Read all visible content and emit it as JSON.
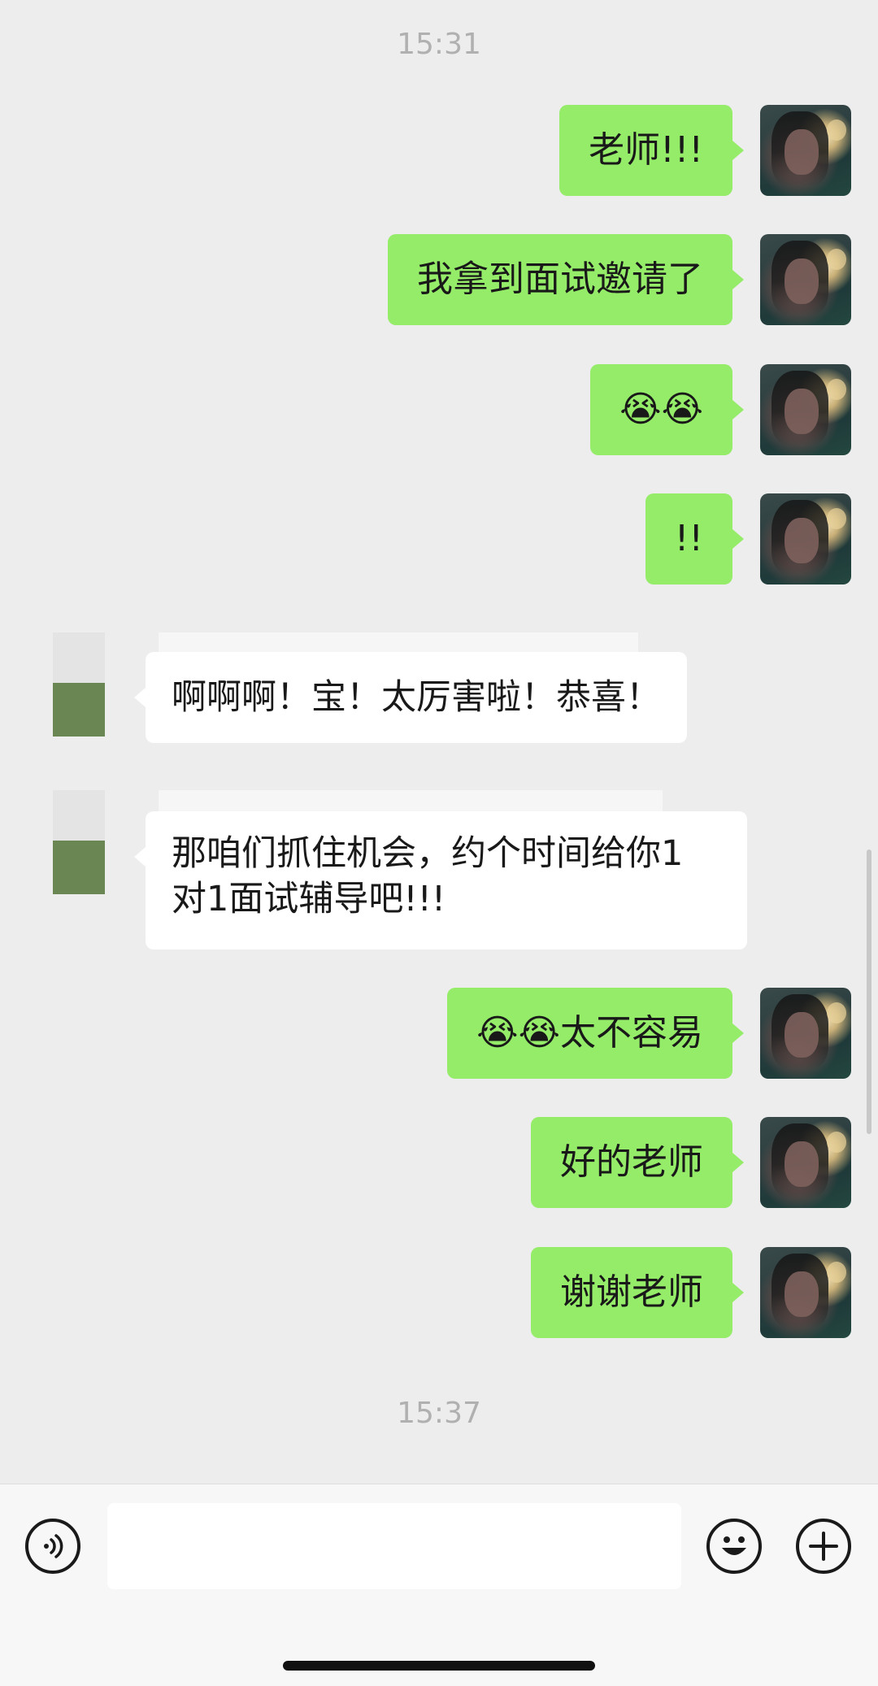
{
  "chat": {
    "timestamp_top": "15:31",
    "timestamp_bottom": "15:37",
    "messages": [
      {
        "sender": "me",
        "text": "老师!!!"
      },
      {
        "sender": "me",
        "text": "我拿到面试邀请了"
      },
      {
        "sender": "me",
        "text": "😭😭"
      },
      {
        "sender": "me",
        "text": "!!"
      },
      {
        "sender": "other",
        "text": "啊啊啊！宝！太厉害啦！恭喜！"
      },
      {
        "sender": "other",
        "line1": "那咱们抓住机会，约个时间给你1",
        "line2": "对1面试辅导吧!!!"
      },
      {
        "sender": "me",
        "text": "😭😭太不容易"
      },
      {
        "sender": "me",
        "text": "好的老师"
      },
      {
        "sender": "me",
        "text": "谢谢老师"
      }
    ]
  },
  "input_bar": {
    "voice_icon": "voice-icon",
    "emoji_icon": "emoji-icon",
    "plus_icon": "plus-icon",
    "message_value": ""
  },
  "colors": {
    "my_bubble": "#95ec69",
    "other_bubble": "#ffffff",
    "background": "#ededed"
  }
}
